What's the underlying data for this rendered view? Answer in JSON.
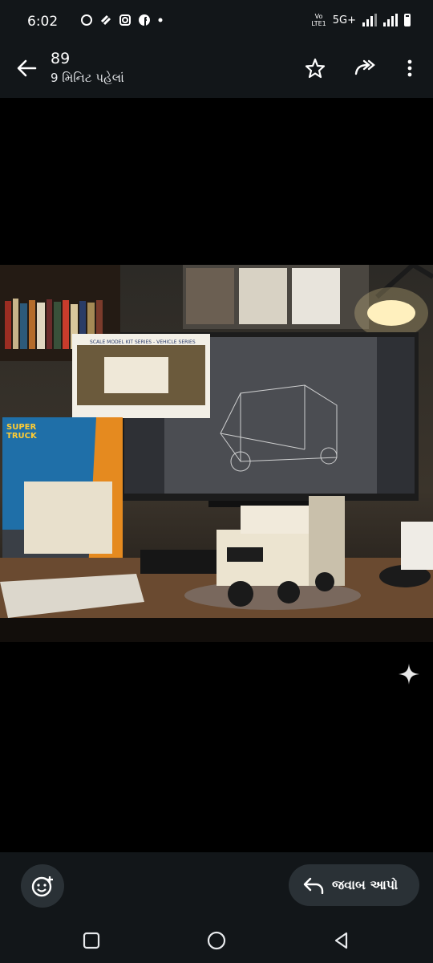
{
  "status_bar": {
    "time": "6:02",
    "left_icons": [
      "whatsapp-icon",
      "link-icon",
      "instagram-icon",
      "facebook-icon",
      "dot-icon"
    ],
    "volte": "Vo\nLTE1",
    "network": "5G+",
    "battery_percent": 80
  },
  "header": {
    "title": "89",
    "subtitle": "9 મિનિટ પહેલાં",
    "actions": [
      "star-icon",
      "forward-icon",
      "more-icon"
    ]
  },
  "media": {
    "type": "image",
    "description_icon": "sparkle-icon"
  },
  "footer": {
    "reply_label": "જવાબ આપો",
    "emoji_icon": "emoji-add-icon"
  },
  "nav": [
    "recents-icon",
    "home-icon",
    "back-icon"
  ],
  "colors": {
    "bar_bg": "#121619",
    "button_bg": "#2a3136"
  }
}
